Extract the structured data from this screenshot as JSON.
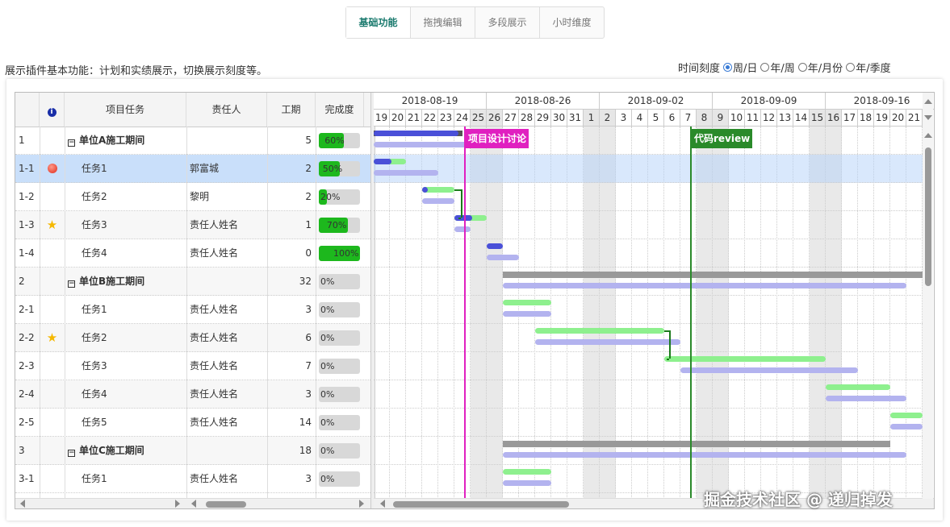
{
  "tabs": [
    {
      "label": "基础功能",
      "active": true
    },
    {
      "label": "拖拽编辑",
      "active": false
    },
    {
      "label": "多段展示",
      "active": false
    },
    {
      "label": "小时维度",
      "active": false
    }
  ],
  "description": "展示插件基本功能：计划和实绩展示，切换展示刻度等。",
  "scale": {
    "label": "时间刻度",
    "options": [
      "周/日",
      "年/周",
      "年/月份",
      "年/季度"
    ],
    "selected": 0
  },
  "grid": {
    "headers": {
      "info_icon": "info-icon",
      "task": "项目任务",
      "owner": "责任人",
      "duration": "工期",
      "progress": "完成度"
    },
    "rows": [
      {
        "id": "1",
        "name": "单位A施工期间",
        "owner": "",
        "duration": "5",
        "progress": 60,
        "progress_text": "60%",
        "group": true,
        "icon": ""
      },
      {
        "id": "1-1",
        "name": "任务1",
        "owner": "郭富城",
        "duration": "2",
        "progress": 50,
        "progress_text": "50%",
        "group": false,
        "icon": "red-dot-icon"
      },
      {
        "id": "1-2",
        "name": "任务2",
        "owner": "黎明",
        "duration": "2",
        "progress": 20,
        "progress_text": "20%",
        "group": false,
        "icon": ""
      },
      {
        "id": "1-3",
        "name": "任务3",
        "owner": "责任人姓名",
        "duration": "1",
        "progress": 70,
        "progress_text": "70%",
        "group": false,
        "icon": "star-icon"
      },
      {
        "id": "1-4",
        "name": "任务4",
        "owner": "责任人姓名",
        "duration": "0",
        "progress": 100,
        "progress_text": "100%",
        "group": false,
        "icon": ""
      },
      {
        "id": "2",
        "name": "单位B施工期间",
        "owner": "",
        "duration": "32",
        "progress": 0,
        "progress_text": "0%",
        "group": true,
        "icon": ""
      },
      {
        "id": "2-1",
        "name": "任务1",
        "owner": "责任人姓名",
        "duration": "3",
        "progress": 0,
        "progress_text": "0%",
        "group": false,
        "icon": ""
      },
      {
        "id": "2-2",
        "name": "任务2",
        "owner": "责任人姓名",
        "duration": "6",
        "progress": 0,
        "progress_text": "0%",
        "group": false,
        "icon": "star-icon"
      },
      {
        "id": "2-3",
        "name": "任务3",
        "owner": "责任人姓名",
        "duration": "7",
        "progress": 0,
        "progress_text": "0%",
        "group": false,
        "icon": ""
      },
      {
        "id": "2-4",
        "name": "任务4",
        "owner": "责任人姓名",
        "duration": "3",
        "progress": 0,
        "progress_text": "0%",
        "group": false,
        "icon": ""
      },
      {
        "id": "2-5",
        "name": "任务5",
        "owner": "责任人姓名",
        "duration": "14",
        "progress": 0,
        "progress_text": "0%",
        "group": false,
        "icon": ""
      },
      {
        "id": "3",
        "name": "单位C施工期间",
        "owner": "",
        "duration": "18",
        "progress": 0,
        "progress_text": "0%",
        "group": true,
        "icon": ""
      },
      {
        "id": "3-1",
        "name": "任务1",
        "owner": "责任人姓名",
        "duration": "3",
        "progress": 0,
        "progress_text": "0%",
        "group": false,
        "icon": ""
      }
    ],
    "selected_row": 1
  },
  "timeline": {
    "weeks": [
      "2018-08-19",
      "2018-08-26",
      "2018-09-02",
      "2018-09-09",
      "2018-09-16"
    ],
    "days": [
      "19",
      "20",
      "21",
      "22",
      "23",
      "24",
      "25",
      "26",
      "27",
      "28",
      "29",
      "30",
      "31",
      "1",
      "2",
      "3",
      "4",
      "5",
      "6",
      "7",
      "8",
      "9",
      "10",
      "11",
      "12",
      "13",
      "14",
      "15",
      "16",
      "17",
      "18",
      "19",
      "20",
      "21"
    ],
    "weekend_days": [
      6,
      7,
      13,
      14,
      20,
      21,
      27,
      28
    ],
    "markers": [
      {
        "label": "项目设计讨论",
        "day": 5.6,
        "color": "#e020c0"
      },
      {
        "label": "代码review",
        "day": 19.6,
        "color": "#2a8a2a"
      }
    ],
    "bars": [
      {
        "row": 0,
        "actual": [
          0,
          5.5
        ],
        "plan": [
          0,
          9
        ],
        "actual_type": "done",
        "summary": true
      },
      {
        "row": 1,
        "actual": [
          0,
          2
        ],
        "plan": [
          0,
          4
        ],
        "actual_type": "done-partial"
      },
      {
        "row": 2,
        "actual": [
          3,
          5
        ],
        "plan": [
          3,
          5
        ],
        "actual_type": "actual-dot"
      },
      {
        "row": 3,
        "actual": [
          5,
          7
        ],
        "plan": [
          5,
          6
        ],
        "actual_type": "done-partial"
      },
      {
        "row": 4,
        "actual": [
          7,
          8
        ],
        "plan": [
          7,
          9
        ],
        "actual_type": "done"
      },
      {
        "row": 5,
        "actual": [
          8,
          34
        ],
        "plan": [
          8,
          33
        ],
        "actual_type": "summary"
      },
      {
        "row": 6,
        "actual": [
          8,
          11
        ],
        "plan": [
          8,
          11
        ],
        "actual_type": "actual"
      },
      {
        "row": 7,
        "actual": [
          10,
          18
        ],
        "plan": [
          10,
          19
        ],
        "actual_type": "actual"
      },
      {
        "row": 8,
        "actual": [
          18,
          28
        ],
        "plan": [
          19,
          30
        ],
        "actual_type": "actual"
      },
      {
        "row": 9,
        "actual": [
          28,
          32
        ],
        "plan": [
          28,
          33
        ],
        "actual_type": "actual"
      },
      {
        "row": 10,
        "actual": [
          32,
          34
        ],
        "plan": [
          32,
          34
        ],
        "actual_type": "actual"
      },
      {
        "row": 11,
        "actual": [
          8,
          32
        ],
        "plan": [
          8,
          33
        ],
        "actual_type": "summary"
      },
      {
        "row": 12,
        "actual": [
          8,
          11
        ],
        "plan": [
          8,
          11
        ],
        "actual_type": "actual"
      }
    ]
  },
  "watermark": "掘金技术社区 @ 递归掉发"
}
